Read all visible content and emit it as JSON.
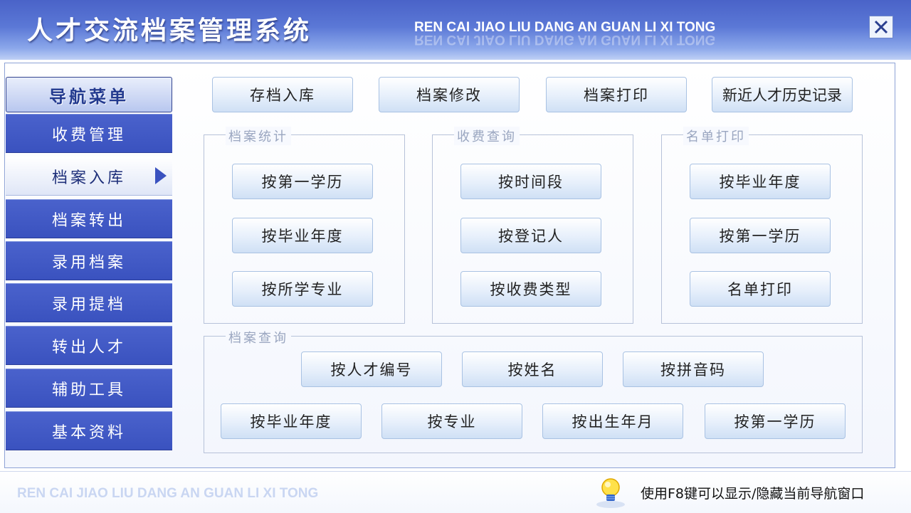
{
  "header": {
    "title": "人才交流档案管理系统",
    "pinyin": "REN CAI JIAO LIU DANG AN GUAN LI XI TONG",
    "close_icon": "close-icon"
  },
  "sidebar": {
    "header": "导航菜单",
    "items": [
      {
        "label": "收费管理"
      },
      {
        "label": "档案入库",
        "active": true
      },
      {
        "label": "档案转出"
      },
      {
        "label": "录用档案"
      },
      {
        "label": "录用提档"
      },
      {
        "label": "转出人才"
      },
      {
        "label": "辅助工具"
      },
      {
        "label": "基本资料"
      }
    ]
  },
  "toolbar": {
    "buttons": [
      "存档入库",
      "档案修改",
      "档案打印",
      "新近人才历史记录"
    ]
  },
  "groups": {
    "archive_stats": {
      "legend": "档案统计",
      "buttons": [
        "按第一学历",
        "按毕业年度",
        "按所学专业"
      ]
    },
    "fee_query": {
      "legend": "收费查询",
      "buttons": [
        "按时间段",
        "按登记人",
        "按收费类型"
      ]
    },
    "list_print": {
      "legend": "名单打印",
      "buttons": [
        "按毕业年度",
        "按第一学历",
        "名单打印"
      ]
    },
    "archive_query": {
      "legend": "档案查询",
      "row1": [
        "按人才编号",
        "按姓名",
        "按拼音码"
      ],
      "row2": [
        "按毕业年度",
        "按专业",
        "按出生年月",
        "按第一学历"
      ]
    }
  },
  "footer": {
    "pinyin": "REN CAI JIAO LIU DANG AN GUAN LI XI TONG",
    "hint": "使用F8键可以显示/隐藏当前导航窗口",
    "icon": "lightbulb-icon"
  }
}
